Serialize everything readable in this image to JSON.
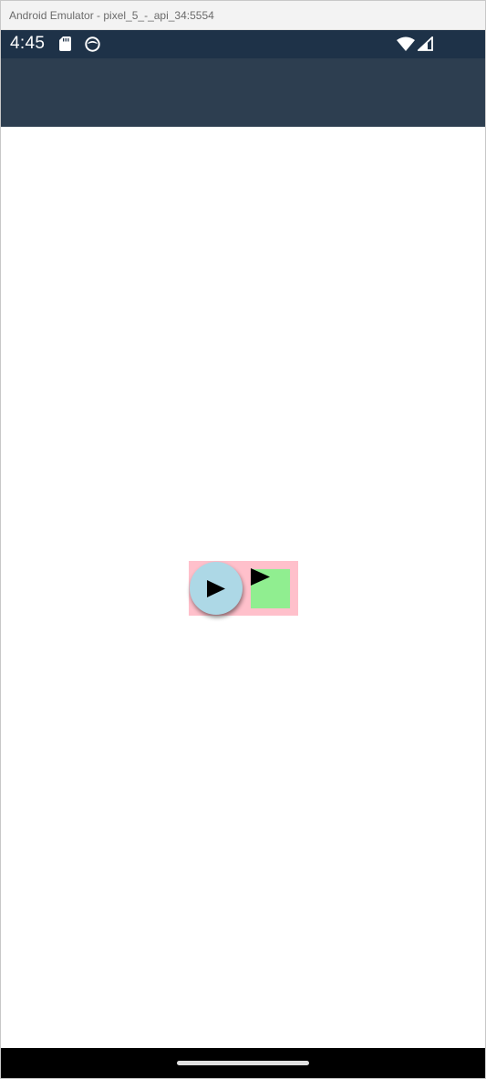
{
  "window": {
    "title": "Android Emulator - pixel_5_-_api_34:5554"
  },
  "status_bar": {
    "time": "4:45",
    "icons": [
      "sd-card-icon",
      "face-icon",
      "wifi-icon",
      "cellular-signal-icon"
    ],
    "background_color": "#1e3248"
  },
  "app_bar": {
    "background_color": "#2d3e50"
  },
  "content": {
    "container_color": "#ffc0cb",
    "round_button": {
      "icon": "play-icon",
      "color": "#add8e6"
    },
    "square_button": {
      "icon": "play-icon",
      "color": "#90ee90"
    }
  },
  "nav_bar": {
    "indicator": "home-indicator"
  }
}
